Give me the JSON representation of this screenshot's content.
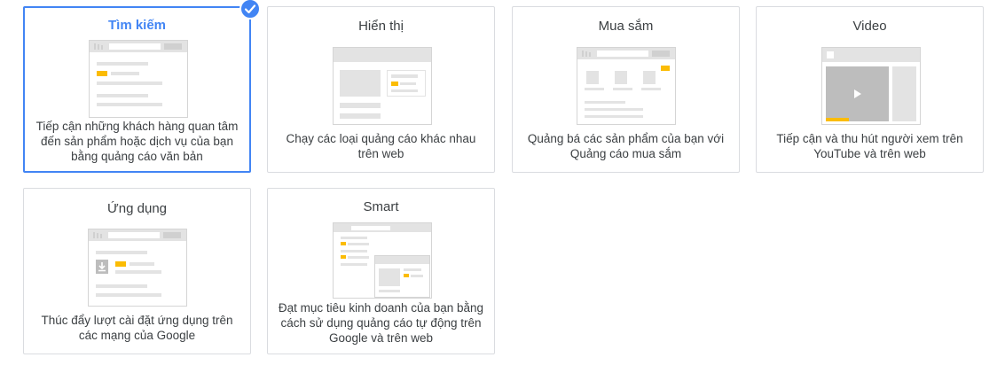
{
  "cards": [
    {
      "title": "Tìm kiếm",
      "description": "Tiếp cận những khách hàng quan tâm đến sản phẩm hoặc dịch vụ của bạn bằng quảng cáo văn bản"
    },
    {
      "title": "Hiển thị",
      "description": "Chạy các loại quảng cáo khác nhau trên web"
    },
    {
      "title": "Mua sắm",
      "description": "Quảng bá các sản phẩm của bạn với Quảng cáo mua sắm"
    },
    {
      "title": "Video",
      "description": "Tiếp cận và thu hút người xem trên YouTube và trên web"
    },
    {
      "title": "Ứng dụng",
      "description": "Thúc đẩy lượt cài đặt ứng dụng trên các mạng của Google"
    },
    {
      "title": "Smart",
      "description": "Đạt mục tiêu kinh doanh của bạn bằng cách sử dụng quảng cáo tự động trên Google và trên web"
    }
  ],
  "selected_card": "Tìm kiếm",
  "colors": {
    "accent": "#4285f4",
    "highlight": "#fbbc04",
    "border": "#dadce0"
  }
}
